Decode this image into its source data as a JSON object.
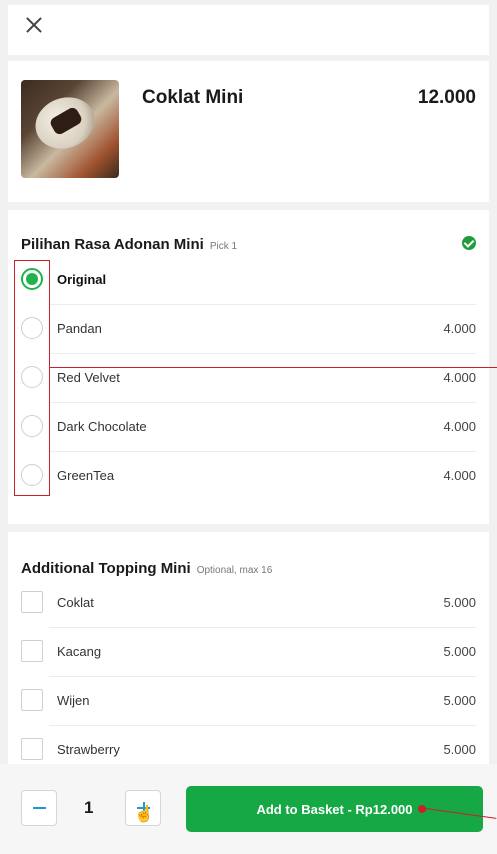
{
  "header": {
    "close_icon": "close-icon"
  },
  "product": {
    "name": "Coklat Mini",
    "price": "12.000"
  },
  "rasa": {
    "title": "Pilihan Rasa Adonan Mini",
    "subtitle": "Pick 1",
    "status_icon": "check-circle-icon",
    "accent": "#1fb34a",
    "options": [
      {
        "label": "Original",
        "price": "",
        "selected": true
      },
      {
        "label": "Pandan",
        "price": "4.000",
        "selected": false
      },
      {
        "label": "Red Velvet",
        "price": "4.000",
        "selected": false
      },
      {
        "label": "Dark Chocolate",
        "price": "4.000",
        "selected": false
      },
      {
        "label": "GreenTea",
        "price": "4.000",
        "selected": false
      }
    ]
  },
  "topping": {
    "title": "Additional Topping Mini",
    "subtitle": "Optional, max 16",
    "options": [
      {
        "label": "Coklat",
        "price": "5.000",
        "checked": false
      },
      {
        "label": "Kacang",
        "price": "5.000",
        "checked": false
      },
      {
        "label": "Wijen",
        "price": "5.000",
        "checked": false
      },
      {
        "label": "Strawberry",
        "price": "5.000",
        "checked": false
      }
    ]
  },
  "footer": {
    "quantity": "1",
    "cta_label": "Add to Basket - Rp12.000",
    "cta_color": "#17a846",
    "qty_icon_color": "#1f9ad1"
  },
  "annotation_color": "#c9202a"
}
